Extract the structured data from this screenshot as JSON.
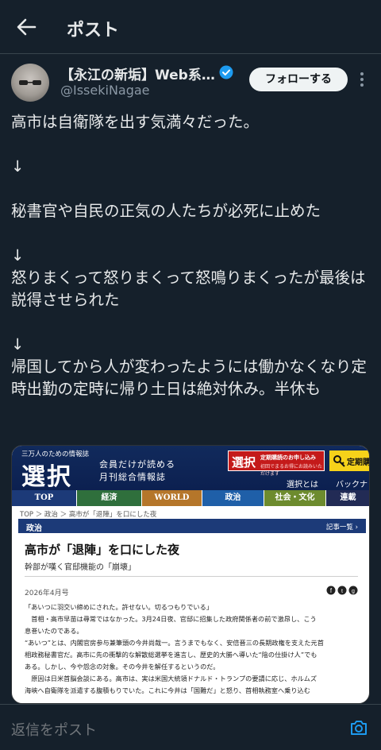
{
  "header": {
    "title": "ポスト"
  },
  "author": {
    "display_name": "【永江の新垢】Web系…",
    "handle": "@IssekiNagae",
    "follow_label": "フォローする"
  },
  "tweet": {
    "text": "高市は自衛隊を出す気満々だった。\n\n↓\n\n秘書官や自民の正気の人たちが必死に止めた\n\n↓\n怒りまくって怒りまくって怒鳴りまくったが最後は説得させられた\n\n↓\n帰国してから人が変わったようには働かなくなり定時出勤の定時に帰り土日は絶対休み。半休も"
  },
  "card": {
    "site_tagline": "三万人のための情報誌",
    "site_logo": "選択",
    "site_slogan_1": "会員だけが読める",
    "site_slogan_2": "月刊総合情報誌",
    "sub_logo": "選択",
    "sub_line1": "定期購読のお申し込み",
    "sub_line2": "初回でまるお得にお読みいただけます",
    "login_label": "定期購",
    "link_about": "選択とは",
    "link_back": "バックナ",
    "nav": [
      {
        "label": "TOP",
        "color": "#1c3a78",
        "width": 82
      },
      {
        "label": "経済",
        "color": "#2f6f3c",
        "width": 82
      },
      {
        "label": "WORLD",
        "color": "#b5762a",
        "width": 76
      },
      {
        "label": "政治",
        "color": "#1f5fa8",
        "width": 78
      },
      {
        "label": "社会・文化",
        "color": "#6d8b2e",
        "width": 78
      },
      {
        "label": "連載",
        "color": "#222b55",
        "width": 56
      }
    ],
    "crumbs": "TOP ＞ 政治 ＞ 高市が「退陣」を口にした夜",
    "section": "政治",
    "section_link": "記事一覧 ›",
    "article_title": "高市が「退陣」を口にした夜",
    "article_subtitle": "幹部が嘆く官邸機能の「崩壊」",
    "date": "2026年4月号",
    "body": [
      "「あいつに羽交い締めにされた。許せない。切るつもりでいる」",
      "　首相・高市早苗は尋常ではなかった。3月24日夜、官邸に招集した政府関係者の前で激昂し、こう",
      "息巻いたのである。",
      "“あいつ”とは、内閣官房参与兼筆頭の今井尚哉一。言うまでもなく、安倍晋三の長期政権を支えた元首",
      "相政務秘書官だ。高市に先の衝撃的な解散総選挙を進言し、歴史的大勝へ導いた“陰の仕掛け人”でも",
      "ある。しかし、今や怨念の対象。その今井を解任するというのだ。",
      "　原因は日米首脳会談にある。高市は、実は米国大統領ドナルド・トランプの要請に応じ、ホルムズ",
      "海峡へ自衛隊を派遣する腹積もりでいた。これに今井は「国難だ」と怒り、首相執務室へ乗り込む"
    ]
  },
  "reply": {
    "placeholder": "返信をポスト"
  },
  "colors": {
    "background": "#15202b",
    "text": "#e7e9ea",
    "muted": "#71767b",
    "accent": "#1d9bf0"
  }
}
